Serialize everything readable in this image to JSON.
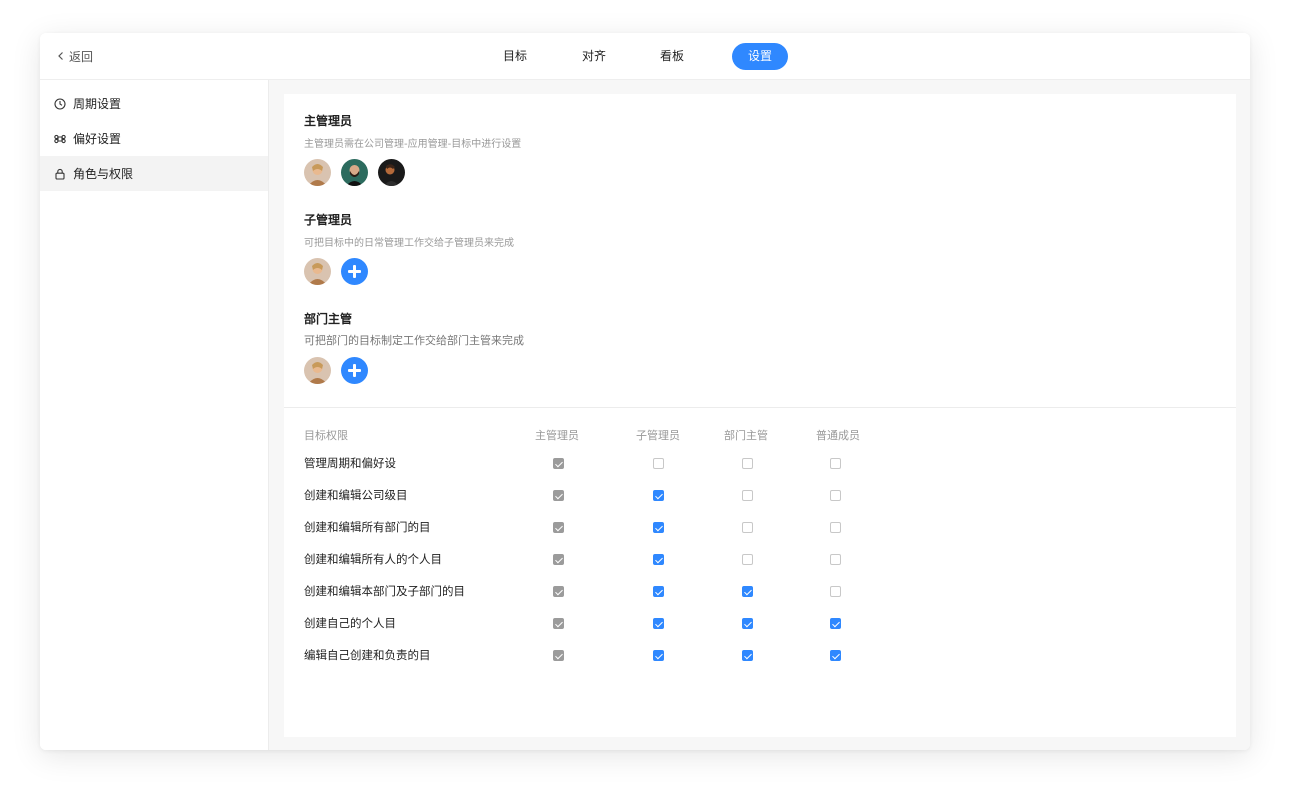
{
  "topbar": {
    "back_label": "返回",
    "tabs": [
      {
        "label": "目标",
        "active": false
      },
      {
        "label": "对齐",
        "active": false
      },
      {
        "label": "看板",
        "active": false
      },
      {
        "label": "设置",
        "active": true
      }
    ]
  },
  "sidebar": {
    "items": [
      {
        "label": "周期设置",
        "icon": "clock-icon",
        "active": false
      },
      {
        "label": "偏好设置",
        "icon": "command-icon",
        "active": false
      },
      {
        "label": "角色与权限",
        "icon": "lock-icon",
        "active": true
      }
    ]
  },
  "roles": {
    "main_admin": {
      "title": "主管理员",
      "desc": "主管理员需在公司管理-应用管理-目标中进行设置"
    },
    "sub_admin": {
      "title": "子管理员",
      "desc": "可把目标中的日常管理工作交给子管理员来完成"
    },
    "dept_head": {
      "title": "部门主管",
      "desc": "可把部门的目标制定工作交给部门主管来完成"
    }
  },
  "permissions": {
    "headers": [
      "目标权限",
      "主管理员",
      "子管理员",
      "部门主管",
      "普通成员"
    ],
    "rows": [
      {
        "label": "管理周期和偏好设",
        "checks": [
          "gray",
          "off",
          "off",
          "off"
        ]
      },
      {
        "label": "创建和编辑公司级目",
        "checks": [
          "gray",
          "blue",
          "off",
          "off"
        ]
      },
      {
        "label": "创建和编辑所有部门的目",
        "checks": [
          "gray",
          "blue",
          "off",
          "off"
        ]
      },
      {
        "label": "创建和编辑所有人的个人目",
        "checks": [
          "gray",
          "blue",
          "off",
          "off"
        ]
      },
      {
        "label": "创建和编辑本部门及子部门的目",
        "checks": [
          "gray",
          "blue",
          "blue",
          "off"
        ]
      },
      {
        "label": "创建自己的个人目",
        "checks": [
          "gray",
          "blue",
          "blue",
          "blue"
        ]
      },
      {
        "label": "编辑自己创建和负责的目",
        "checks": [
          "gray",
          "blue",
          "blue",
          "blue"
        ]
      }
    ]
  },
  "colors": {
    "accent": "#2f88ff",
    "checked_disabled": "#9b9b9b"
  }
}
